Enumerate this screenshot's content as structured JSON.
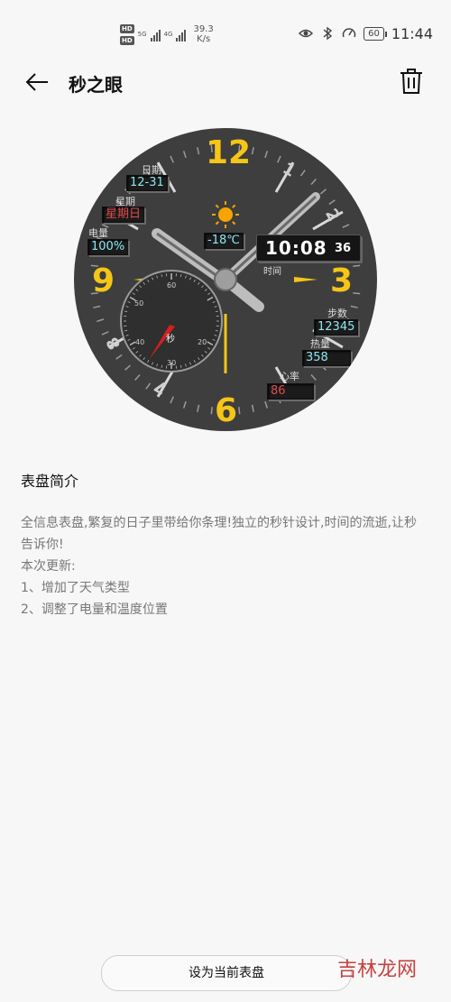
{
  "status_bar": {
    "hd1": "HD",
    "hd2": "HD",
    "net1": "5G",
    "net2": "4G",
    "speed_value": "39.3",
    "speed_unit": "K/s",
    "battery": "60",
    "time": "11:44",
    "icons": [
      "eye-icon",
      "bluetooth-icon",
      "speedometer-icon",
      "battery-icon"
    ]
  },
  "app_bar": {
    "title": "秒之眼",
    "back_icon": "arrow-left-icon",
    "delete_icon": "trash-icon"
  },
  "watch_face": {
    "date_label": "日期",
    "date_value": "12-31",
    "week_label": "星期",
    "week_value": "星期日",
    "battery_label": "电量",
    "battery_value": "100%",
    "temperature": "-18℃",
    "weather_icon": "sun-icon",
    "time_main": "10:08",
    "time_seconds": "36",
    "time_label": "时间",
    "steps_label": "步数",
    "steps_value": "12345",
    "calories_label": "热量",
    "calories_value": "358",
    "heart_label": "心率",
    "heart_value": "86",
    "seconds_dial_label": "秒",
    "seconds_dial_numbers": [
      "60",
      "50",
      "40",
      "30",
      "20"
    ],
    "hour_numerals": {
      "n12": "12",
      "n3": "3",
      "n6": "6",
      "n9": "9",
      "n1": "1",
      "n2": "2",
      "n7": "7",
      "n8": "8"
    },
    "colors": {
      "face": "#3e3e3e",
      "numerals": "#f5c518",
      "lcd_text": "#8ee6f2",
      "alert_text": "#e04b4b"
    }
  },
  "description": {
    "title": "表盘简介",
    "line1": "全信息表盘,繁复的日子里带给你条理!独立的秒针设计,时间的流逝,让秒告诉你!",
    "line2": "本次更新:",
    "line3": "1、增加了天气类型",
    "line4": "2、调整了电量和温度位置"
  },
  "apply_button": "设为当前表盘",
  "watermark": "吉林龙网"
}
